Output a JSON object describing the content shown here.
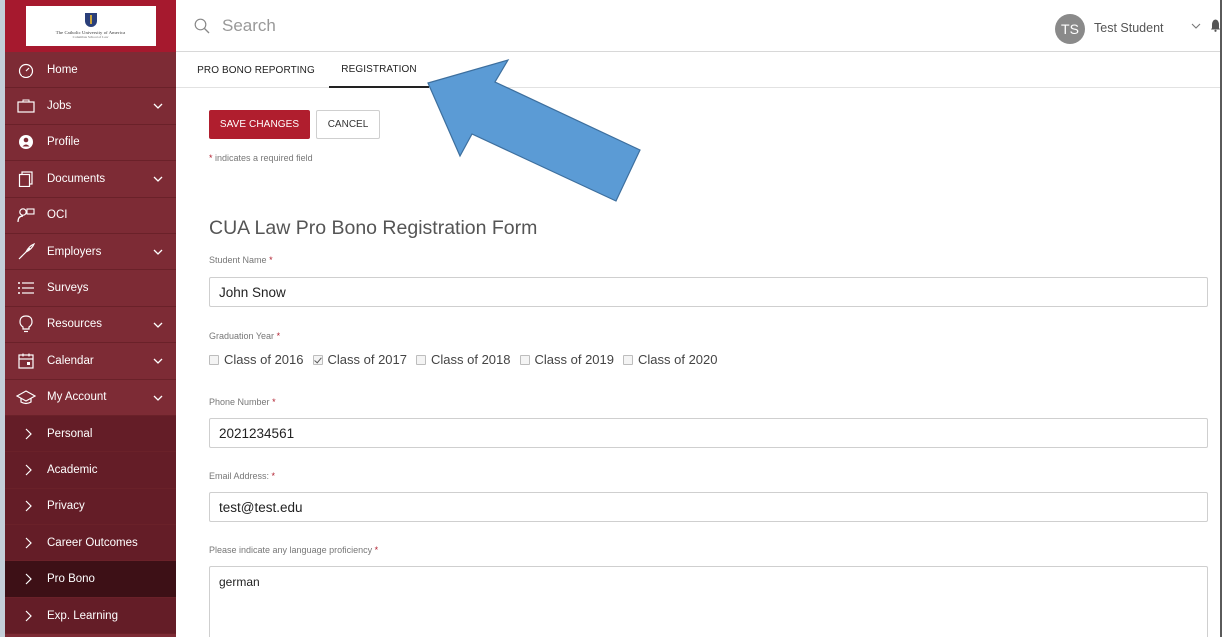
{
  "sidebar": {
    "logo": {
      "text": "The Catholic University of America",
      "subtext": "Columbus School of Law"
    },
    "items": [
      {
        "label": "Home",
        "icon": "dashboard-icon",
        "expandable": false
      },
      {
        "label": "Jobs",
        "icon": "briefcase-icon",
        "expandable": true
      },
      {
        "label": "Profile",
        "icon": "user-circle-icon",
        "expandable": false
      },
      {
        "label": "Documents",
        "icon": "documents-icon",
        "expandable": true
      },
      {
        "label": "OCI",
        "icon": "interview-icon",
        "expandable": false
      },
      {
        "label": "Employers",
        "icon": "rocket-icon",
        "expandable": true
      },
      {
        "label": "Surveys",
        "icon": "list-icon",
        "expandable": false
      },
      {
        "label": "Resources",
        "icon": "lightbulb-icon",
        "expandable": true
      },
      {
        "label": "Calendar",
        "icon": "calendar-icon",
        "expandable": true
      },
      {
        "label": "My Account",
        "icon": "graduation-cap-icon",
        "expandable": true
      }
    ],
    "subitems": [
      {
        "label": "Personal"
      },
      {
        "label": "Academic"
      },
      {
        "label": "Privacy"
      },
      {
        "label": "Career Outcomes"
      },
      {
        "label": "Pro Bono",
        "active": true
      },
      {
        "label": "Exp. Learning"
      }
    ]
  },
  "topbar": {
    "search_placeholder": "Search",
    "avatar_initials": "TS",
    "user_name": "Test Student"
  },
  "tabs": {
    "pro_bono_reporting": "PRO BONO REPORTING",
    "registration": "REGISTRATION",
    "active": "registration"
  },
  "form": {
    "save_label": "SAVE CHANGES",
    "cancel_label": "CANCEL",
    "required_note": "indicates a required field",
    "required_marker": "*",
    "title": "CUA Law Pro Bono Registration Form",
    "student_name_label": "Student Name",
    "student_name_value": "John Snow",
    "graduation_year_label": "Graduation Year",
    "graduation_options": [
      {
        "label": "Class of 2016",
        "checked": false
      },
      {
        "label": "Class of 2017",
        "checked": true
      },
      {
        "label": "Class of 2018",
        "checked": false
      },
      {
        "label": "Class of 2019",
        "checked": false
      },
      {
        "label": "Class of 2020",
        "checked": false
      }
    ],
    "phone_label": "Phone Number",
    "phone_value": "2021234561",
    "email_label": "Email Address:",
    "email_value": "test@test.edu",
    "language_label": "Please indicate any language proficiency",
    "language_value": "german"
  },
  "colors": {
    "sidebar_bg": "#7d2b35",
    "logo_bg": "#a6192e",
    "submenu_bg": "#641d27",
    "active_item_bg": "#3d1016",
    "primary_button": "#b01e2e",
    "annotation_arrow": "#5b9bd5"
  }
}
